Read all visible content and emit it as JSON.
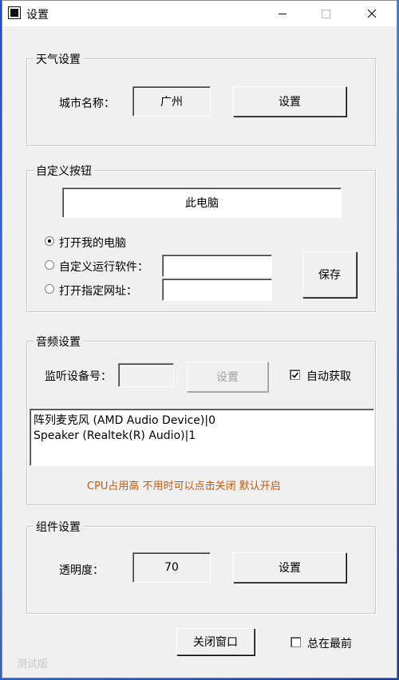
{
  "window": {
    "title": "设置"
  },
  "weather": {
    "group_title": "天气设置",
    "city_label": "城市名称：",
    "city_value": "广州",
    "set_button": "设置"
  },
  "custom_button": {
    "group_title": "自定义按钮",
    "button_text": "此电脑",
    "options": [
      {
        "label": "打开我的电脑",
        "checked": true
      },
      {
        "label": "自定义运行软件：",
        "checked": false
      },
      {
        "label": "打开指定网址：",
        "checked": false
      }
    ],
    "software_path": "",
    "url": "",
    "save_button": "保存"
  },
  "audio": {
    "group_title": "音频设置",
    "device_label": "监听设备号：",
    "device_value": "",
    "set_button": "设置",
    "auto_get_label": "自动获取",
    "auto_get_checked": true,
    "devices": [
      "阵列麦克风 (AMD Audio Device)|0",
      "Speaker (Realtek(R) Audio)|1"
    ],
    "note": "CPU占用高  不用时可以点击关闭 默认开启"
  },
  "component": {
    "group_title": "组件设置",
    "opacity_label": "透明度：",
    "opacity_value": "70",
    "set_button": "设置"
  },
  "footer": {
    "close_button": "关闭窗口",
    "always_on_top_label": "总在最前",
    "always_on_top_checked": false,
    "version_text": "测试版"
  },
  "colors": {
    "note": "#c05a10",
    "window_bg": "#f0f0f0"
  }
}
